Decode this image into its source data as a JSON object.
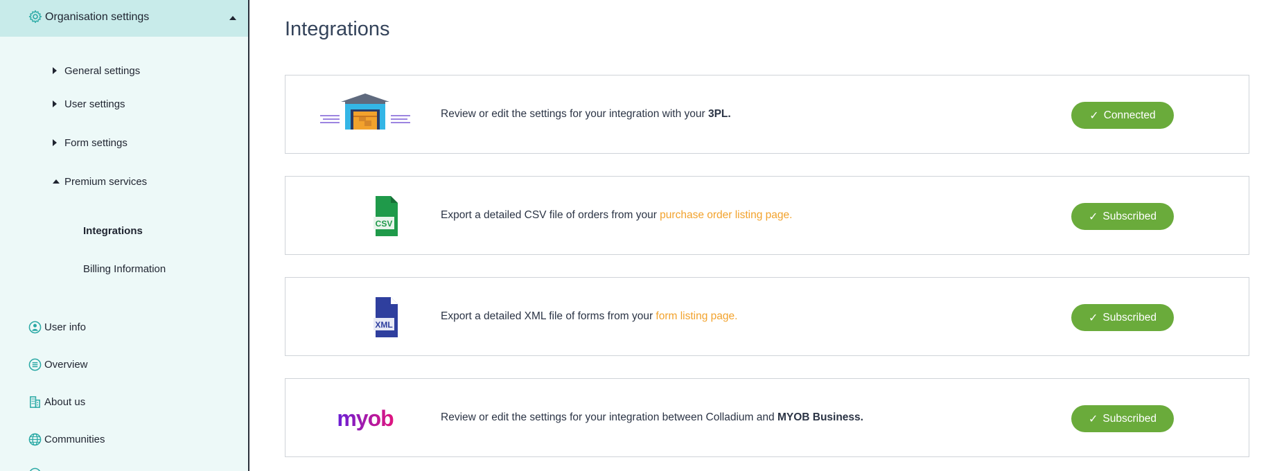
{
  "sidebar": {
    "org_settings_label": "Organisation settings",
    "sub_items": [
      {
        "label": "General settings"
      },
      {
        "label": "User settings"
      },
      {
        "label": "Form settings"
      },
      {
        "label": "Premium services"
      }
    ],
    "premium_children": [
      {
        "label": "Integrations"
      },
      {
        "label": "Billing Information"
      }
    ],
    "nav": [
      {
        "label": "User info",
        "icon": "person-circle-icon"
      },
      {
        "label": "Overview",
        "icon": "list-circle-icon"
      },
      {
        "label": "About us",
        "icon": "building-icon"
      },
      {
        "label": "Communities",
        "icon": "globe-icon"
      }
    ]
  },
  "main": {
    "title": "Integrations",
    "cards": [
      {
        "logo": "warehouse-icon",
        "desc_prefix": "Review or edit the settings for your integration with your ",
        "desc_strong": "3PL.",
        "status": "Connected"
      },
      {
        "logo": "csv-file-icon",
        "logo_text": "CSV",
        "desc_prefix": "Export a detailed CSV file of orders from your ",
        "desc_link": "purchase order listing page.",
        "status": "Subscribed"
      },
      {
        "logo": "xml-file-icon",
        "logo_text": "XML",
        "desc_prefix": "Export a detailed XML file of forms from your ",
        "desc_link": "form listing page.",
        "status": "Subscribed"
      },
      {
        "logo": "myob-logo",
        "logo_text": "myob",
        "desc_prefix": "Review or edit the settings for your integration between Colladium and ",
        "desc_strong": "MYOB Business.",
        "status": "Subscribed"
      }
    ]
  },
  "colors": {
    "accent_green": "#6aab3b",
    "link_orange": "#f2a22c",
    "sidebar_bg": "#edf9f8",
    "sidebar_header_bg": "#c8ebea",
    "icon_teal": "#2aa9a5"
  },
  "check_glyph": "✓"
}
